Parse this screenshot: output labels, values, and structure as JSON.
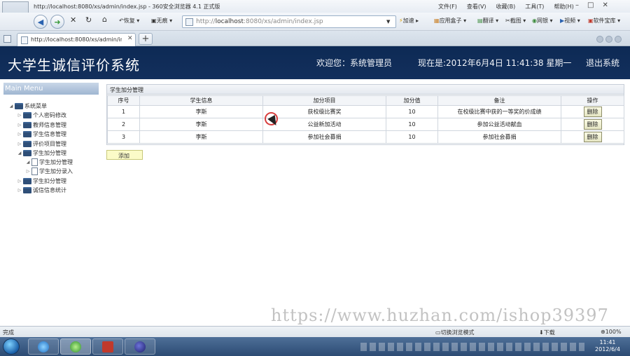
{
  "browser": {
    "window_title": "http://localhost:8080/xs/admin/index.jsp - 360安全浏览器 4.1 正式版",
    "menus": [
      "文件(F)",
      "查看(V)",
      "收藏(B)",
      "工具(T)",
      "帮助(H)"
    ],
    "toolbar": {
      "restore_label": "恢复",
      "no_trace_label": "无痕",
      "address_prefix": "http://",
      "address_host": "localhost",
      "address_rest": ":8080/xs/admin/index.jsp",
      "accelerate_label": "加速",
      "apps_label": "应用盒子",
      "translate_label": "翻译",
      "screenshot_label": "截图",
      "netbank_label": "网银",
      "video_label": "视频",
      "software_label": "软件宝库"
    },
    "tab": {
      "label": "http://localhost:8080/xs/admin/in..."
    },
    "status": {
      "left": "完成",
      "mode": "切换浏览模式",
      "downloads": "下载",
      "zoom": "100%"
    }
  },
  "app": {
    "title": "大学生诚信评价系统",
    "welcome": "欢迎您：系统管理员",
    "now": "现在是:2012年6月4日  11:41:38 星期一",
    "logout": "退出系统"
  },
  "menu": {
    "header": "Main Menu",
    "root": "系统菜单",
    "items": [
      {
        "label": "个人密码修改"
      },
      {
        "label": "教师信息管理"
      },
      {
        "label": "学生信息管理"
      },
      {
        "label": "评价项目管理"
      },
      {
        "label": "学生加分管理"
      },
      {
        "label": "学生加分管理"
      },
      {
        "label": "学生加分录入"
      },
      {
        "label": "学生扣分管理"
      },
      {
        "label": "诚信信息统计"
      }
    ]
  },
  "panel": {
    "title": "学生加分管理",
    "columns": [
      "序号",
      "学生信息",
      "加分项目",
      "加分值",
      "备注",
      "操作"
    ],
    "rows": [
      {
        "no": "1",
        "student": "李斯",
        "item": "获校级比赛奖",
        "score": "10",
        "note": "在校级比赛中获的一等奖的价成绩",
        "action": "删除"
      },
      {
        "no": "2",
        "student": "李斯",
        "item": "公益新加活动",
        "score": "10",
        "note": "参加公益活动献血",
        "action": "删除"
      },
      {
        "no": "3",
        "student": "李斯",
        "item": "参加社会募捐",
        "score": "10",
        "note": "参加社会募捐",
        "action": "删除"
      }
    ],
    "add_label": "添加"
  },
  "watermark": "https://www.huzhan.com/ishop39397",
  "taskbar": {
    "time": "11:41",
    "date": "2012/6/4"
  },
  "colors": {
    "header_bg": "#132f5c",
    "menu_header": "#9fb6d1",
    "add_button": "#fbfbc8",
    "delete_button": "#e5e5c3"
  }
}
